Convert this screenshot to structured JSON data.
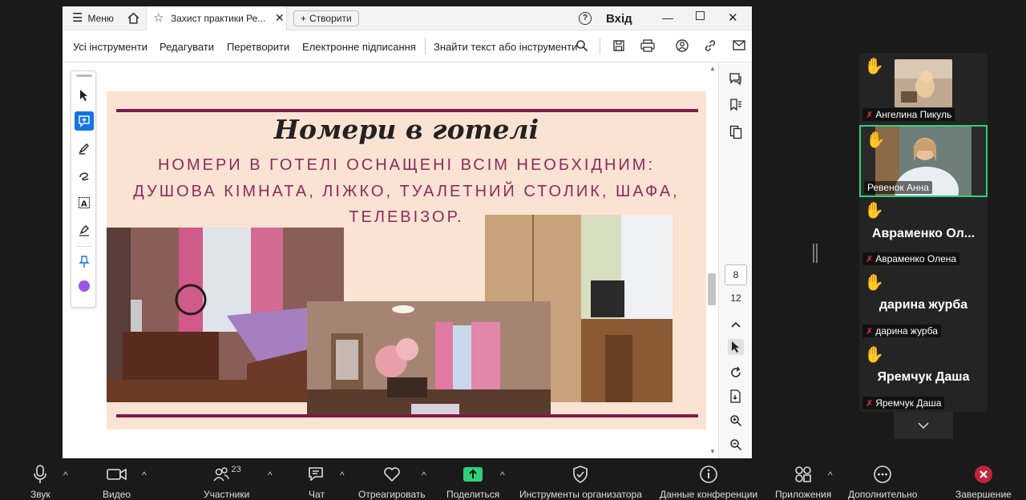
{
  "acrobat": {
    "menu_label": "Меню",
    "tab_title": "Захист практики Ре...",
    "create_label": "Створити",
    "signin_label": "Вхід",
    "toolbar": {
      "all_tools": "Усі інструменти",
      "edit": "Редагувати",
      "convert": "Перетворити",
      "esign": "Електронне підписання",
      "search": "Знайти текст або інструменти"
    },
    "page_current": "8",
    "page_total": "12"
  },
  "slide": {
    "title": "Номери в готелі",
    "body_line1": "НОМЕРИ В ГОТЕЛІ ОСНАЩЕНІ ВСІМ НЕОБХІДНИМ:",
    "body_line2": "ДУШОВА КІМНАТА, ЛІЖКО, ТУАЛЕТНИЙ СТОЛИК, ШАФА,",
    "body_line3": "ТЕЛЕВІЗОР.",
    "accent_color": "#7e1a4a"
  },
  "participants": [
    {
      "name": "Ангелина Пикуль",
      "display": ""
    },
    {
      "name": "Ревенок Анна",
      "display": ""
    },
    {
      "name": "Авраменко Олена",
      "display": "Авраменко  Ол..."
    },
    {
      "name": "дарина журба",
      "display": "дарина журба"
    },
    {
      "name": "Яремчук Даша",
      "display": "Яремчук Даша"
    }
  ],
  "zoom": {
    "audio": "Звук",
    "video": "Видео",
    "participants": "Участники",
    "participants_count": "23",
    "chat": "Чат",
    "react": "Отреагировать",
    "share": "Поделиться",
    "host_tools": "Инструменты организатора",
    "meeting_info": "Данные конференции",
    "apps": "Приложения",
    "more": "Дополнительно",
    "end": "Завершение"
  }
}
